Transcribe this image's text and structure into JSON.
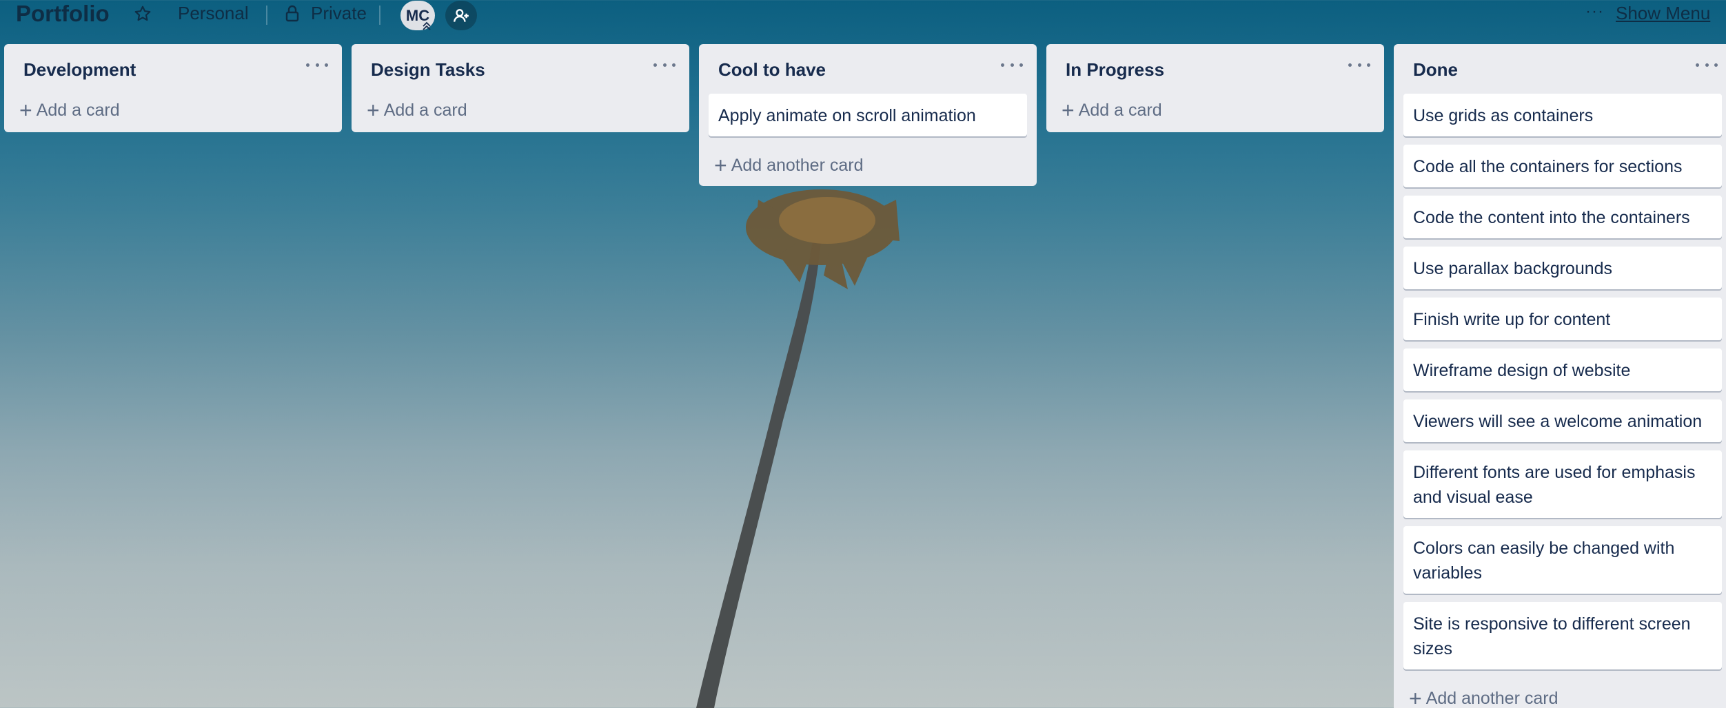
{
  "board": {
    "title": "Portfolio",
    "team": "Personal",
    "visibility": "Private",
    "member_initials": "MC",
    "more_dots": "···",
    "show_menu": "Show Menu"
  },
  "icons": {
    "star": "star-icon",
    "lock": "lock-icon",
    "invite": "add-member-icon",
    "badge": "chevron-up-icon"
  },
  "colors": {
    "list_bg": "#ebecf0",
    "card_bg": "#ffffff",
    "text": "#172b4d",
    "muted": "#5e6c84",
    "sky_top": "#0c5f80",
    "sky_bottom": "#bcc5c5"
  },
  "lists": [
    {
      "title": "Development",
      "cards": [],
      "add_label": "Add a card"
    },
    {
      "title": "Design Tasks",
      "cards": [],
      "add_label": "Add a card"
    },
    {
      "title": "Cool to have",
      "cards": [
        "Apply animate on scroll animation"
      ],
      "add_label": "Add another card"
    },
    {
      "title": "In Progress",
      "cards": [],
      "add_label": "Add a card"
    },
    {
      "title": "Done",
      "cards": [
        "Use grids as containers",
        "Code all the containers for sections",
        "Code the content into the containers",
        "Use parallax backgrounds",
        "Finish write up for content",
        "Wireframe design of website",
        "Viewers will see a welcome animation",
        "Different fonts are used for emphasis and visual ease",
        "Colors can easily be changed with variables",
        "Site is responsive to different screen sizes"
      ],
      "add_label": "Add another card"
    }
  ]
}
